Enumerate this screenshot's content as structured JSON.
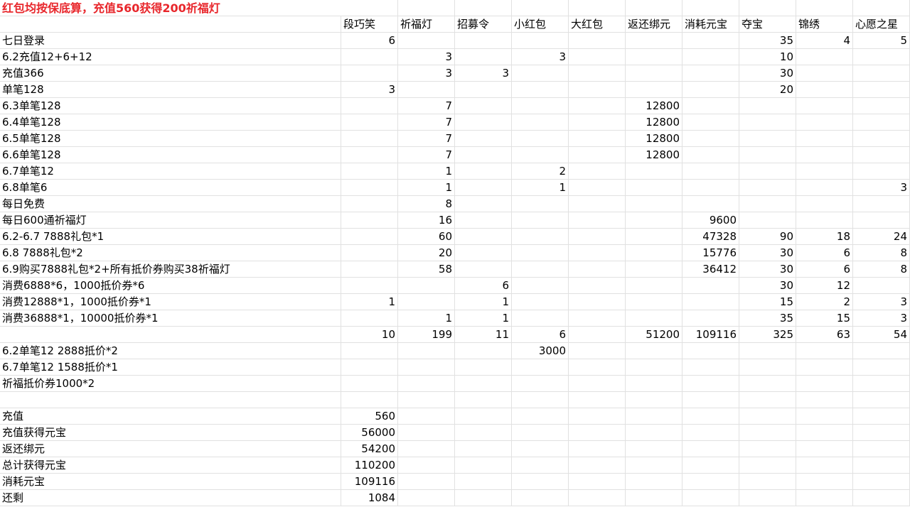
{
  "title": "红包均按保底算，充值560获得200祈福灯",
  "headers": [
    "",
    "段巧笑",
    "祈福灯",
    "招募令",
    "小红包",
    "大红包",
    "返还绑元",
    "消耗元宝",
    "夺宝",
    "锦绣",
    "心愿之星"
  ],
  "rows": [
    [
      "七日登录",
      "6",
      "",
      "",
      "",
      "",
      "",
      "",
      "35",
      "4",
      "5"
    ],
    [
      "6.2充值12+6+12",
      "",
      "3",
      "",
      "3",
      "",
      "",
      "",
      "10",
      "",
      ""
    ],
    [
      "充值366",
      "",
      "3",
      "3",
      "",
      "",
      "",
      "",
      "30",
      "",
      ""
    ],
    [
      "单笔128",
      "3",
      "",
      "",
      "",
      "",
      "",
      "",
      "20",
      "",
      ""
    ],
    [
      "6.3单笔128",
      "",
      "7",
      "",
      "",
      "",
      "12800",
      "",
      "",
      "",
      ""
    ],
    [
      "6.4单笔128",
      "",
      "7",
      "",
      "",
      "",
      "12800",
      "",
      "",
      "",
      ""
    ],
    [
      "6.5单笔128",
      "",
      "7",
      "",
      "",
      "",
      "12800",
      "",
      "",
      "",
      ""
    ],
    [
      "6.6单笔128",
      "",
      "7",
      "",
      "",
      "",
      "12800",
      "",
      "",
      "",
      ""
    ],
    [
      "6.7单笔12",
      "",
      "1",
      "",
      "2",
      "",
      "",
      "",
      "",
      "",
      ""
    ],
    [
      "6.8单笔6",
      "",
      "1",
      "",
      "1",
      "",
      "",
      "",
      "",
      "",
      "3"
    ],
    [
      "每日免费",
      "",
      "8",
      "",
      "",
      "",
      "",
      "",
      "",
      "",
      ""
    ],
    [
      "每日600通祈福灯",
      "",
      "16",
      "",
      "",
      "",
      "",
      "9600",
      "",
      "",
      ""
    ],
    [
      "6.2-6.7  7888礼包*1",
      "",
      "60",
      "",
      "",
      "",
      "",
      "47328",
      "90",
      "18",
      "24"
    ],
    [
      "6.8  7888礼包*2",
      "",
      "20",
      "",
      "",
      "",
      "",
      "15776",
      "30",
      "6",
      "8"
    ],
    [
      "6.9购买7888礼包*2+所有抵价券购买38祈福灯",
      "",
      "58",
      "",
      "",
      "",
      "",
      "36412",
      "30",
      "6",
      "8"
    ],
    [
      "消费6888*6，1000抵价券*6",
      "",
      "",
      "6",
      "",
      "",
      "",
      "",
      "30",
      "12",
      ""
    ],
    [
      "消费12888*1，1000抵价券*1",
      "1",
      "",
      "1",
      "",
      "",
      "",
      "",
      "15",
      "2",
      "3"
    ],
    [
      "消费36888*1，10000抵价券*1",
      "",
      "1",
      "1",
      "",
      "",
      "",
      "",
      "35",
      "15",
      "3"
    ],
    [
      "",
      "10",
      "199",
      "11",
      "6",
      "",
      "51200",
      "109116",
      "325",
      "63",
      "54"
    ],
    [
      "6.2单笔12 2888抵价*2",
      "",
      "",
      "",
      "3000",
      "",
      "",
      "",
      "",
      "",
      ""
    ],
    [
      "6.7单笔12 1588抵价*1",
      "",
      "",
      "",
      "",
      "",
      "",
      "",
      "",
      "",
      ""
    ],
    [
      "祈福抵价券1000*2",
      "",
      "",
      "",
      "",
      "",
      "",
      "",
      "",
      "",
      ""
    ],
    [
      "",
      "",
      "",
      "",
      "",
      "",
      "",
      "",
      "",
      "",
      ""
    ],
    [
      "充值",
      "560",
      "",
      "",
      "",
      "",
      "",
      "",
      "",
      "",
      ""
    ],
    [
      "充值获得元宝",
      "56000",
      "",
      "",
      "",
      "",
      "",
      "",
      "",
      "",
      ""
    ],
    [
      "返还绑元",
      "54200",
      "",
      "",
      "",
      "",
      "",
      "",
      "",
      "",
      ""
    ],
    [
      "总计获得元宝",
      "110200",
      "",
      "",
      "",
      "",
      "",
      "",
      "",
      "",
      ""
    ],
    [
      "消耗元宝",
      "109116",
      "",
      "",
      "",
      "",
      "",
      "",
      "",
      "",
      ""
    ],
    [
      "还剩",
      "1084",
      "",
      "",
      "",
      "",
      "",
      "",
      "",
      "",
      ""
    ]
  ]
}
